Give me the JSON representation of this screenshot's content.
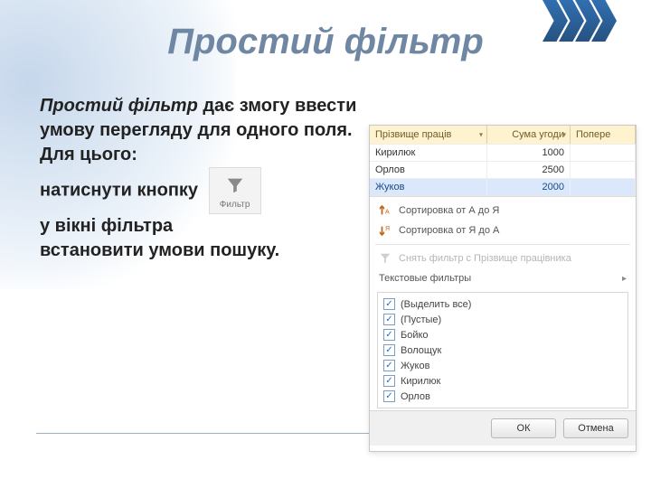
{
  "slide": {
    "title": "Простий фільтр",
    "lead": "Простий фільтр",
    "body_after_lead": " дає змогу ввести умову перегляду для одного поля.",
    "line2a": "Для цього:",
    "line2b": "натиснути кнопку",
    "line3": "у вікні фільтра",
    "line4": "встановити умови пошуку.",
    "filter_btn_caption": "Фильтр"
  },
  "table": {
    "headers": {
      "c1": "Прізвище праців",
      "c2": "Сума угоди",
      "c3": "Попере"
    },
    "rows": [
      {
        "c1": "Кирилюк",
        "c2": "1000"
      },
      {
        "c1": "Орлов",
        "c2": "2500"
      },
      {
        "c1": "Жуков",
        "c2": "2000"
      }
    ]
  },
  "dropdown": {
    "sort_az": "Сортировка от А до Я",
    "sort_za": "Сортировка от Я до А",
    "clear": "Снять фильтр с Прізвище працівника",
    "text_filters": "Текстовые фильтры",
    "items": [
      "(Выделить все)",
      "(Пустые)",
      "Бойко",
      "Волощук",
      "Жуков",
      "Кирилюк",
      "Орлов"
    ],
    "ok": "ОК",
    "cancel": "Отмена"
  }
}
